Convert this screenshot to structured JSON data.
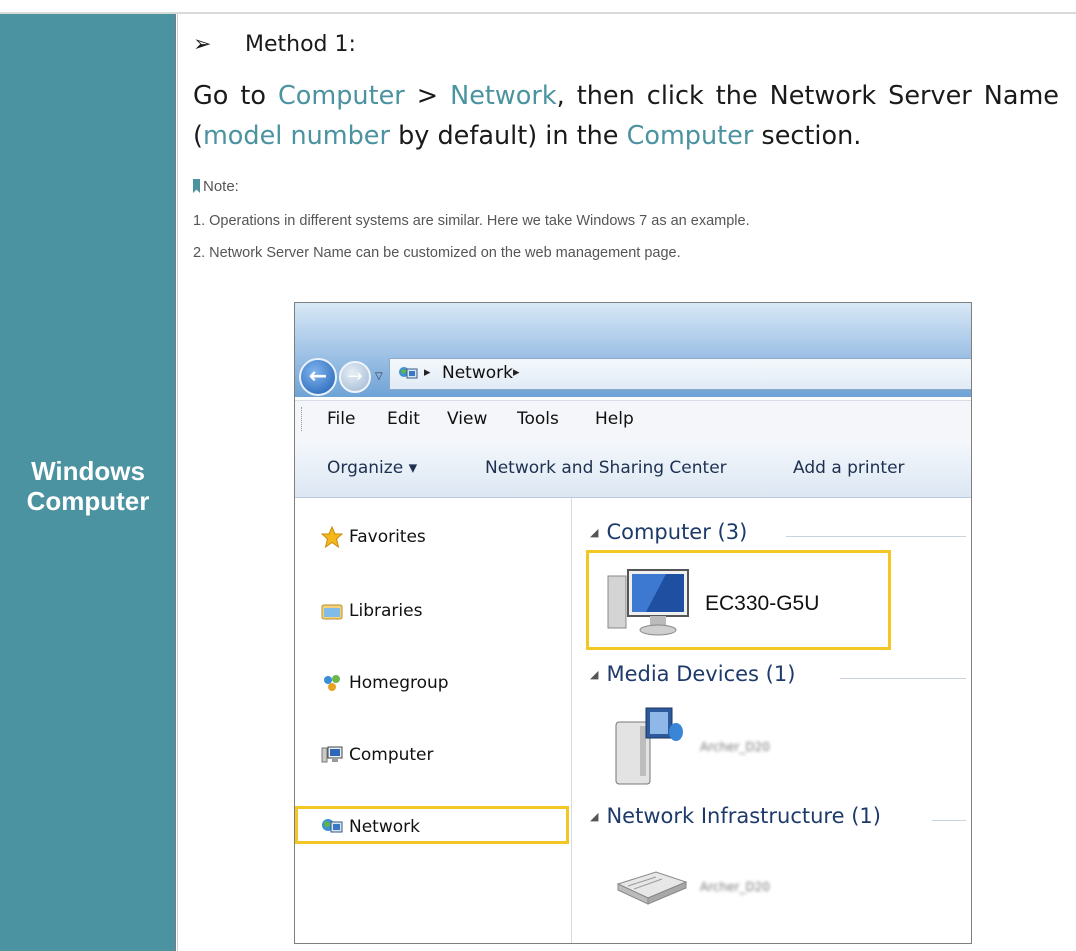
{
  "sidebar": {
    "label_line1": "Windows",
    "label_line2": "Computer"
  },
  "method": {
    "title": "Method 1:"
  },
  "instruction": {
    "t1": "Go to ",
    "h1": "Computer",
    "t2": " > ",
    "h2": "Network",
    "t3": ", then click the Network Server Name (",
    "h3": "model number",
    "t4": " by default) in the ",
    "h4": "Computer",
    "t5": " section."
  },
  "note": {
    "heading": "Note:",
    "items": [
      "1.  Operations in different systems are similar. Here we take Windows 7 as an example.",
      "2.  Network Server Name can be customized on the web management page."
    ]
  },
  "explorer": {
    "address": "Network",
    "menu": [
      "File",
      "Edit",
      "View",
      "Tools",
      "Help"
    ],
    "commands": [
      "Organize ▾",
      "Network and Sharing Center",
      "Add a printer"
    ],
    "nav_items": [
      "Favorites",
      "Libraries",
      "Homegroup",
      "Computer",
      "Network"
    ],
    "groups": {
      "computer": "Computer (3)",
      "media": "Media Devices (1)",
      "infra": "Network Infrastructure (1)"
    },
    "devices": {
      "computer_name": "EC330-G5U",
      "media_name": "Archer_D20",
      "infra_name": "Archer_D20"
    }
  },
  "colors": {
    "accent": "#4b93a0",
    "highlight_box": "#f2c623"
  }
}
